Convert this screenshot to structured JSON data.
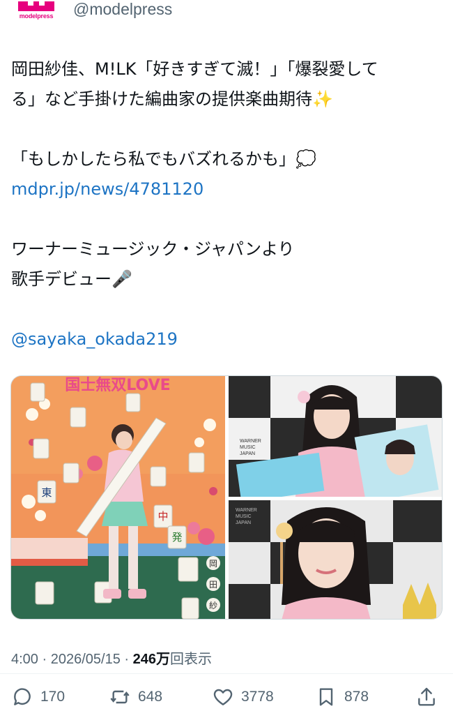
{
  "header": {
    "logo_text": "modelpress",
    "handle": "@modelpress"
  },
  "tweet": {
    "lines": [
      "岡田紗佳、M!LK「好きすぎて滅！」「爆裂愛して",
      "る」など手掛けた編曲家の提供楽曲期待✨",
      "",
      "「もしかしたら私でもバズれるかも」💭",
      "mdpr.jp/news/4781120",
      "",
      "ワーナーミュージック・ジャパンより",
      "歌手デビュー🎤",
      "",
      "@sayaka_okada219"
    ],
    "link": "mdpr.jp/news/4781120",
    "mention": "@sayaka_okada219"
  },
  "media": {
    "main_title": "国士無双LOVE",
    "tile_chars": [
      "東",
      "中",
      "発"
    ],
    "name_chars": [
      "岡",
      "田",
      "紗"
    ],
    "warner_text": [
      "WARNER",
      "MUSIC",
      "JAPAN"
    ]
  },
  "meta": {
    "time": "4:00",
    "date": "2026/05/15",
    "views": "246万",
    "views_label": "回表示",
    "sep": "·"
  },
  "actions": {
    "replies": "170",
    "reposts": "648",
    "likes": "3778",
    "bookmarks": "878"
  },
  "colors": {
    "brand": "#e6007e",
    "link": "#1d74c4",
    "muted": "#536471"
  }
}
